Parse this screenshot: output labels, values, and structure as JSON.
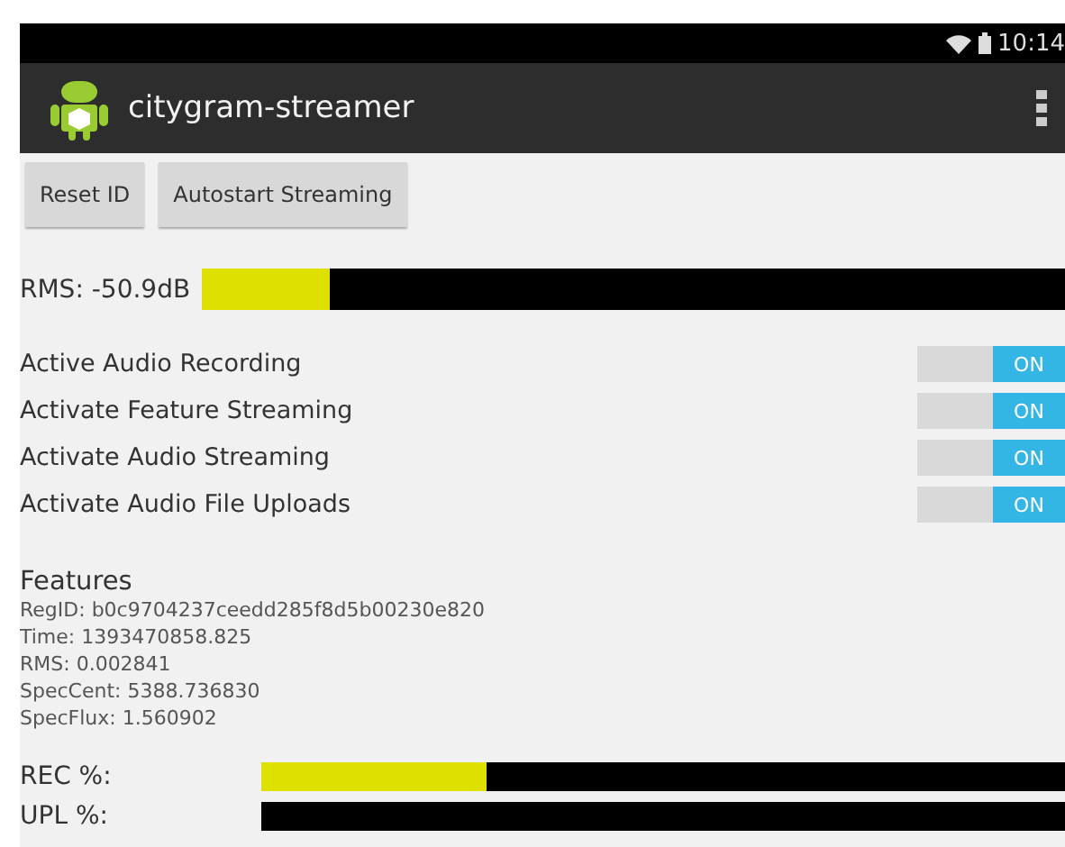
{
  "status_bar": {
    "time": "10:14"
  },
  "action_bar": {
    "title": "citygram-streamer"
  },
  "buttons": [
    "Reset ID",
    "Autostart Streaming"
  ],
  "rms_meter": {
    "label": "RMS: -50.9dB",
    "level": 0.15
  },
  "toggles": [
    {
      "label": "Active Audio Recording",
      "on": true,
      "state_text": "ON"
    },
    {
      "label": "Activate Feature Streaming",
      "on": true,
      "state_text": "ON"
    },
    {
      "label": "Activate Audio Streaming",
      "on": true,
      "state_text": "ON"
    },
    {
      "label": "Activate Audio File Uploads",
      "on": true,
      "state_text": "ON"
    }
  ],
  "features": {
    "heading": "Features",
    "lines": [
      "RegID: b0c9704237ceedd285f8d5b00230e820",
      "Time: 1393470858.825",
      "RMS: 0.002841",
      "SpecCent: 5388.736830",
      "SpecFlux: 1.560902"
    ]
  },
  "progress": [
    {
      "label": "REC %:",
      "level": 0.28
    },
    {
      "label": "UPL %:",
      "level": 0
    }
  ]
}
